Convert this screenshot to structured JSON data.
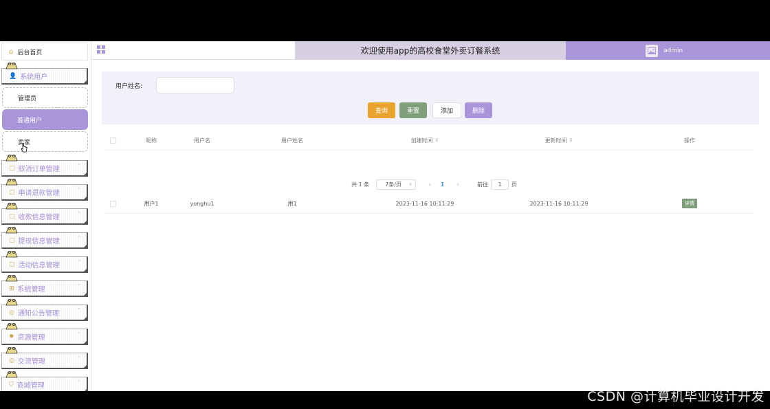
{
  "header": {
    "title": "欢迎使用app的高校食堂外卖订餐系统",
    "username": "admin",
    "brand_color": "#a895da"
  },
  "sidebar": {
    "home": "后台首页",
    "group": "系统用户",
    "sub_items": [
      "管理员",
      "普通用户",
      "卖家"
    ],
    "active_sub": "普通用户",
    "menus": [
      "取消订单管理",
      "申请退款管理",
      "收款信息管理",
      "提现信息管理",
      "活动信息管理",
      "系统管理",
      "通知公告管理",
      "资源管理",
      "交流管理",
      "商城管理"
    ]
  },
  "search": {
    "label": "用户姓名:",
    "placeholder": "",
    "value": ""
  },
  "buttons": {
    "query": "查询",
    "reset": "重置",
    "add": "添加",
    "delete": "删除"
  },
  "table": {
    "columns": [
      "昵称",
      "用户名",
      "用户姓名",
      "创建时间",
      "更新时间",
      "操作"
    ],
    "rows": [
      {
        "nickname": "用户1",
        "username": "yonghu1",
        "realname": "用1",
        "created": "2023-11-16 10:11:29",
        "updated": "2023-11-16 10:11:29",
        "action": "详情"
      }
    ]
  },
  "pagination": {
    "total": "共 1 条",
    "page_size": "7条/页",
    "current_page": "1",
    "goto_label": "前往",
    "goto_value": "1",
    "page_unit": "页"
  },
  "watermark": "CSDN @计算机毕业设计开发"
}
